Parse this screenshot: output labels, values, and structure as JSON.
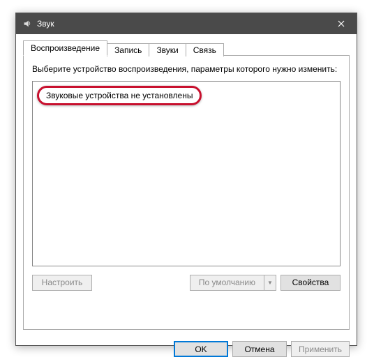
{
  "window": {
    "title": "Звук"
  },
  "tabs": {
    "playback": "Воспроизведение",
    "record": "Запись",
    "sounds": "Звуки",
    "comm": "Связь"
  },
  "panel": {
    "instruction": "Выберите устройство воспроизведения, параметры которого нужно изменить:",
    "no_devices": "Звуковые устройства не установлены",
    "configure": "Настроить",
    "default": "По умолчанию",
    "properties": "Свойства"
  },
  "dialog": {
    "ok": "OK",
    "cancel": "Отмена",
    "apply": "Применить"
  }
}
